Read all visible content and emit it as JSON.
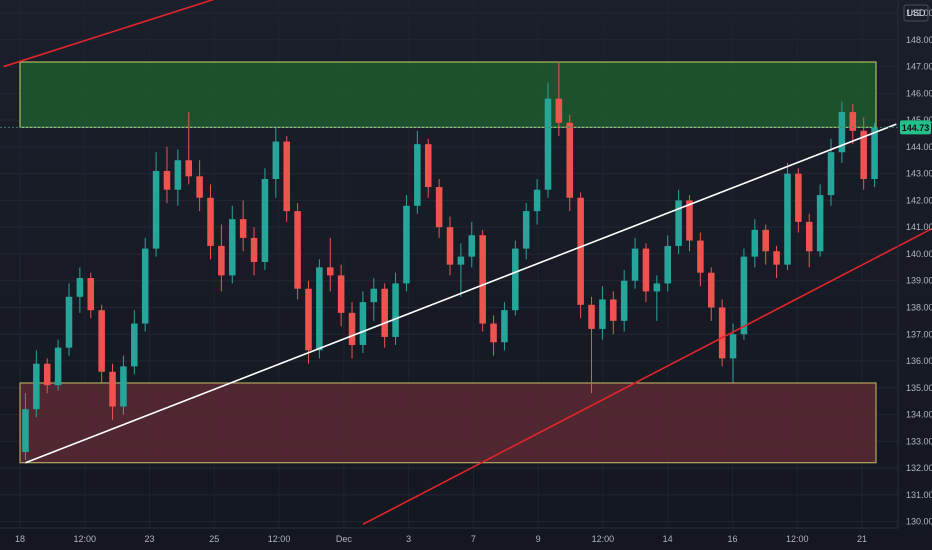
{
  "chart_data": {
    "type": "candlestick",
    "currency": "USD",
    "current_price": "144.73",
    "ylim": [
      129.8,
      149.3
    ],
    "y_ticks": [
      "130.00",
      "131.00",
      "132.00",
      "133.00",
      "134.00",
      "135.00",
      "136.00",
      "137.00",
      "138.00",
      "139.00",
      "140.00",
      "141.00",
      "142.00",
      "143.00",
      "144.00",
      "145.00",
      "146.00",
      "147.00",
      "148.00",
      "149.00"
    ],
    "x_ticks": [
      "18",
      "12:00",
      "23",
      "25",
      "12:00",
      "Dec",
      "3",
      "7",
      "9",
      "12:00",
      "14",
      "16",
      "12:00",
      "21"
    ],
    "zones": [
      {
        "name": "resistance",
        "y_from": 144.73,
        "y_to": 147.17,
        "fill": "#1e5a2e",
        "border": "#c8d86a"
      },
      {
        "name": "support",
        "y_from": 132.2,
        "y_to": 135.18,
        "fill": "#5a2a33",
        "border": "#c8c06a"
      }
    ],
    "trendlines": [
      {
        "name": "white-rising-trendline",
        "color": "#ffffff",
        "from": [
          0,
          132.2
        ],
        "to": [
          80,
          144.85
        ]
      },
      {
        "name": "upper-red-channel-line",
        "color": "#e0242a",
        "from": [
          -2,
          147.0
        ],
        "to": [
          18,
          149.6
        ]
      },
      {
        "name": "lower-red-channel-line",
        "color": "#e0242a",
        "from": [
          31,
          129.9
        ],
        "to": [
          84,
          141.1
        ]
      }
    ],
    "colors": {
      "up": "#26a69a",
      "down": "#ef5350"
    },
    "candles": [
      [
        132.6,
        134.8,
        132.3,
        134.2
      ],
      [
        134.2,
        136.4,
        133.9,
        135.9
      ],
      [
        135.9,
        136.1,
        134.8,
        135.1
      ],
      [
        135.1,
        136.8,
        134.9,
        136.5
      ],
      [
        136.5,
        138.9,
        136.2,
        138.4
      ],
      [
        138.4,
        139.5,
        137.8,
        139.1
      ],
      [
        139.1,
        139.3,
        137.6,
        137.9
      ],
      [
        137.9,
        138.1,
        135.2,
        135.6
      ],
      [
        135.6,
        135.9,
        133.8,
        134.3
      ],
      [
        134.3,
        136.2,
        134.0,
        135.8
      ],
      [
        135.8,
        137.9,
        135.5,
        137.4
      ],
      [
        137.4,
        140.6,
        137.1,
        140.2
      ],
      [
        140.2,
        143.8,
        139.9,
        143.1
      ],
      [
        143.1,
        144.0,
        141.9,
        142.4
      ],
      [
        142.4,
        143.9,
        141.8,
        143.5
      ],
      [
        143.5,
        145.3,
        142.6,
        142.9
      ],
      [
        142.9,
        143.5,
        141.6,
        142.1
      ],
      [
        142.1,
        142.6,
        139.8,
        140.3
      ],
      [
        140.3,
        141.1,
        138.6,
        139.2
      ],
      [
        139.2,
        141.8,
        138.9,
        141.3
      ],
      [
        141.3,
        142.0,
        140.1,
        140.6
      ],
      [
        140.6,
        141.0,
        139.2,
        139.7
      ],
      [
        139.7,
        143.2,
        139.4,
        142.8
      ],
      [
        142.8,
        144.7,
        142.1,
        144.2
      ],
      [
        144.2,
        144.4,
        141.2,
        141.6
      ],
      [
        141.6,
        141.9,
        138.3,
        138.7
      ],
      [
        138.7,
        139.0,
        135.9,
        136.4
      ],
      [
        136.4,
        139.8,
        136.1,
        139.5
      ],
      [
        139.5,
        140.6,
        138.6,
        139.2
      ],
      [
        139.2,
        139.6,
        137.3,
        137.8
      ],
      [
        137.8,
        138.2,
        136.1,
        136.6
      ],
      [
        136.6,
        138.6,
        136.3,
        138.2
      ],
      [
        138.2,
        139.1,
        137.5,
        138.7
      ],
      [
        138.7,
        138.9,
        136.5,
        136.9
      ],
      [
        136.9,
        139.3,
        136.6,
        138.9
      ],
      [
        138.9,
        142.2,
        138.6,
        141.8
      ],
      [
        141.8,
        144.6,
        141.5,
        144.1
      ],
      [
        144.1,
        144.3,
        142.1,
        142.5
      ],
      [
        142.5,
        142.8,
        140.6,
        141.0
      ],
      [
        141.0,
        141.4,
        139.2,
        139.6
      ],
      [
        139.6,
        140.4,
        138.4,
        139.9
      ],
      [
        139.9,
        141.2,
        139.5,
        140.7
      ],
      [
        140.7,
        140.9,
        137.1,
        137.4
      ],
      [
        137.4,
        137.7,
        136.2,
        136.7
      ],
      [
        136.7,
        138.2,
        136.4,
        137.9
      ],
      [
        137.9,
        140.5,
        137.7,
        140.2
      ],
      [
        140.2,
        141.9,
        139.8,
        141.6
      ],
      [
        141.6,
        142.8,
        141.1,
        142.4
      ],
      [
        142.4,
        146.4,
        142.1,
        145.8
      ],
      [
        145.8,
        147.2,
        144.4,
        144.9
      ],
      [
        144.9,
        145.2,
        141.6,
        142.1
      ],
      [
        142.1,
        142.3,
        137.6,
        138.1
      ],
      [
        138.1,
        138.4,
        134.8,
        137.2
      ],
      [
        137.2,
        138.8,
        136.8,
        138.3
      ],
      [
        138.3,
        138.6,
        137.0,
        137.5
      ],
      [
        137.5,
        139.4,
        137.1,
        139.0
      ],
      [
        139.0,
        140.6,
        138.7,
        140.2
      ],
      [
        140.2,
        140.4,
        138.2,
        138.6
      ],
      [
        138.6,
        139.2,
        137.5,
        138.9
      ],
      [
        138.9,
        140.7,
        138.6,
        140.3
      ],
      [
        140.3,
        142.4,
        140.0,
        142.0
      ],
      [
        142.0,
        142.2,
        140.1,
        140.5
      ],
      [
        140.5,
        140.8,
        138.8,
        139.3
      ],
      [
        139.3,
        139.5,
        137.5,
        138.0
      ],
      [
        138.0,
        138.3,
        135.8,
        136.1
      ],
      [
        136.1,
        137.4,
        135.2,
        137.0
      ],
      [
        137.0,
        140.2,
        136.8,
        139.9
      ],
      [
        139.9,
        141.3,
        139.5,
        140.9
      ],
      [
        140.9,
        141.1,
        139.6,
        140.1
      ],
      [
        140.1,
        140.3,
        139.1,
        139.6
      ],
      [
        139.6,
        143.4,
        139.4,
        143.0
      ],
      [
        143.0,
        143.2,
        140.8,
        141.2
      ],
      [
        141.2,
        141.5,
        139.5,
        140.1
      ],
      [
        140.1,
        142.6,
        139.9,
        142.2
      ],
      [
        142.2,
        144.3,
        141.8,
        143.8
      ],
      [
        143.8,
        145.7,
        143.4,
        145.3
      ],
      [
        145.3,
        145.6,
        144.1,
        144.6
      ],
      [
        144.6,
        145.1,
        142.4,
        142.8
      ],
      [
        142.8,
        144.9,
        142.5,
        144.73
      ]
    ]
  }
}
